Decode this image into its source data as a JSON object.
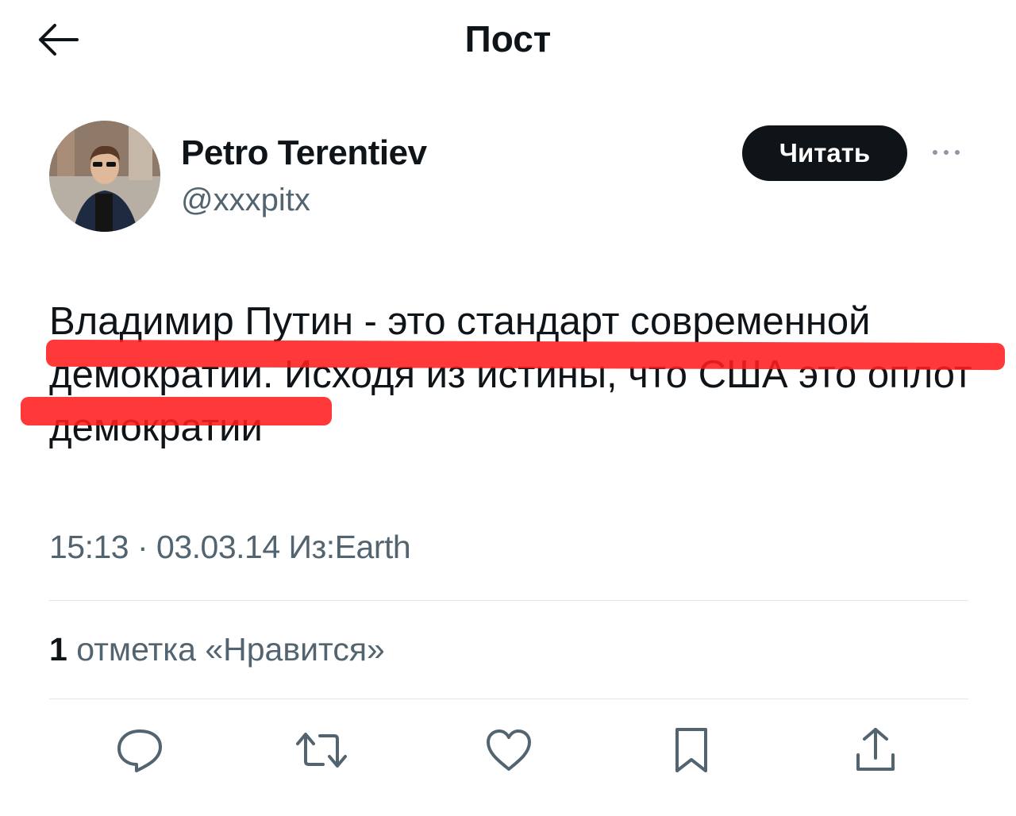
{
  "header": {
    "title": "Пост",
    "back_icon": "arrow-left-icon"
  },
  "author": {
    "display_name": "Petro Terentiev",
    "handle": "@xxxpitx",
    "follow_label": "Читать",
    "more_icon": "more-dots-icon"
  },
  "tweet": {
    "text": "Владимир Путин - это стандарт современной демократии. Исходя из истины, что США это оплот демократии",
    "meta": "15:13 · 03.03.14 Из:Earth"
  },
  "engagement": {
    "likes_count": "1",
    "likes_label": "отметка «Нравится»"
  },
  "actions": [
    {
      "icon": "reply-icon"
    },
    {
      "icon": "retweet-icon"
    },
    {
      "icon": "like-heart-icon"
    },
    {
      "icon": "bookmark-icon"
    },
    {
      "icon": "share-icon"
    }
  ],
  "colors": {
    "text": "#0f1419",
    "secondary": "#536471",
    "button_bg": "#0f1419",
    "annotation_red": "#ff1e1e",
    "divider": "#e1e5e9"
  }
}
